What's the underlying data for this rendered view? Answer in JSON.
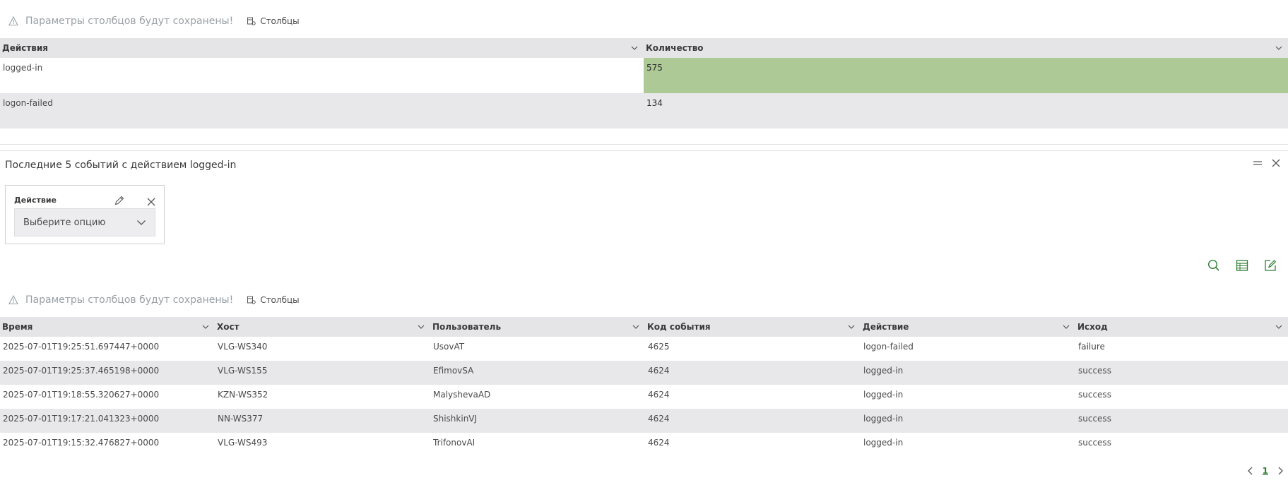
{
  "notice": {
    "text": "Параметры столбцов будут сохранены!",
    "columns_button": "Столбцы"
  },
  "top_table": {
    "columns": [
      "Действия",
      "Количество"
    ],
    "rows": [
      {
        "action": "logged-in",
        "count": "575"
      },
      {
        "action": "logon-failed",
        "count": "134"
      }
    ],
    "colors": {
      "highlight": "#adca96",
      "muted": "#eaecf4"
    }
  },
  "panel": {
    "title": "Последние 5 событий с действием logged-in",
    "filter": {
      "label": "Действие",
      "placeholder": "Выберите опцию"
    }
  },
  "bottom_table": {
    "columns": [
      "Время",
      "Хост",
      "Пользователь",
      "Код события",
      "Действие",
      "Исход"
    ],
    "rows": [
      [
        "2025-07-01T19:25:51.697447+0000",
        "VLG-WS340",
        "UsovAT",
        "4625",
        "logon-failed",
        "failure"
      ],
      [
        "2025-07-01T19:25:37.465198+0000",
        "VLG-WS155",
        "EfimovSA",
        "4624",
        "logged-in",
        "success"
      ],
      [
        "2025-07-01T19:18:55.320627+0000",
        "KZN-WS352",
        "MalyshevaAD",
        "4624",
        "logged-in",
        "success"
      ],
      [
        "2025-07-01T19:17:21.041323+0000",
        "NN-WS377",
        "ShishkinVJ",
        "4624",
        "logged-in",
        "success"
      ],
      [
        "2025-07-01T19:15:32.476827+0000",
        "VLG-WS493",
        "TrifonovAI",
        "4624",
        "logged-in",
        "success"
      ]
    ]
  },
  "pagination": {
    "current": "1"
  },
  "accent_color": "#2e7d32"
}
